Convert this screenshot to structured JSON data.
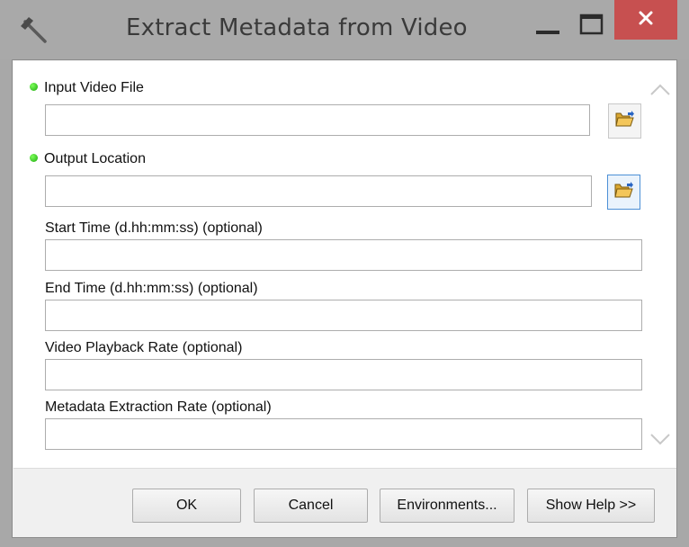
{
  "window": {
    "title": "Extract Metadata from Video",
    "close_glyph": "✕"
  },
  "params": {
    "input_video_file": {
      "label": "Input Video File",
      "value": "",
      "required": true
    },
    "output_location": {
      "label": "Output Location",
      "value": "",
      "required": true
    },
    "start_time": {
      "label": "Start Time (d.hh:mm:ss) (optional)",
      "value": ""
    },
    "end_time": {
      "label": "End Time (d.hh:mm:ss) (optional)",
      "value": ""
    },
    "video_playback_rate": {
      "label": "Video Playback Rate (optional)",
      "value": ""
    },
    "metadata_extraction_rate": {
      "label": "Metadata Extraction Rate (optional)",
      "value": ""
    }
  },
  "buttons": {
    "ok": "OK",
    "cancel": "Cancel",
    "environments": "Environments...",
    "show_help": "Show Help >>"
  },
  "icons": {
    "app": "hammer-icon",
    "minimize": "minimize-icon",
    "maximize": "maximize-icon",
    "close": "close-icon",
    "browse": "open-folder-icon",
    "scroll_up": "chevron-up-icon",
    "scroll_down": "chevron-down-icon"
  },
  "colors": {
    "titlebar": "#a9a9a9",
    "close_button": "#c75050",
    "required_dot": "#2bc018",
    "focus_border": "#4d90d6"
  }
}
